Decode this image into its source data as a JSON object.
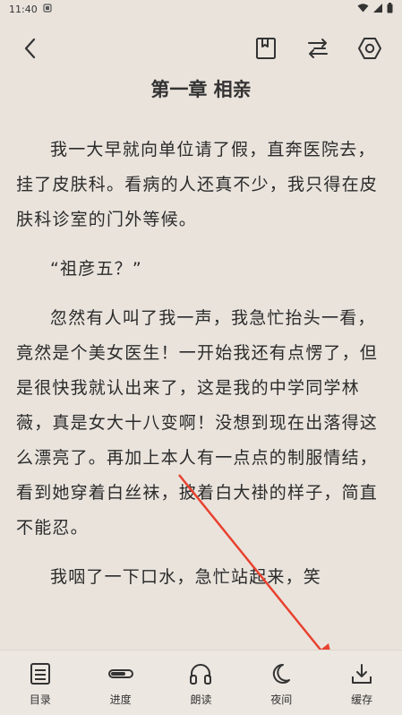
{
  "status": {
    "time": "11:40"
  },
  "chapter": {
    "title": "第一章 相亲"
  },
  "paragraphs": [
    "我一大早就向单位请了假，直奔医院去，挂了皮肤科。看病的人还真不少，我只得在皮肤科诊室的门外等候。",
    "“祖彦五？”",
    "忽然有人叫了我一声，我急忙抬头一看，竟然是个美女医生！一开始我还有点愣了，但是很快我就认出来了，这是我的中学同学林薇，真是女大十八变啊！没想到现在出落得这么漂亮了。再加上本人有一点点的制服情结，看到她穿着白丝袜，披着白大褂的样子，简直不能忍。",
    "我咽了一下口水，急忙站起来，笑"
  ],
  "bottom_nav": [
    {
      "label": "目录",
      "icon": "catalog-icon"
    },
    {
      "label": "进度",
      "icon": "progress-icon"
    },
    {
      "label": "朗读",
      "icon": "headphones-icon"
    },
    {
      "label": "夜间",
      "icon": "moon-icon"
    },
    {
      "label": "缓存",
      "icon": "download-icon"
    }
  ],
  "toolbar": {
    "back_icon": "back-arrow-icon",
    "bookmark_icon": "bookmark-icon",
    "switch_icon": "switch-source-icon",
    "settings_icon": "settings-icon"
  },
  "annotation": {
    "arrow_color": "#e8412f"
  }
}
